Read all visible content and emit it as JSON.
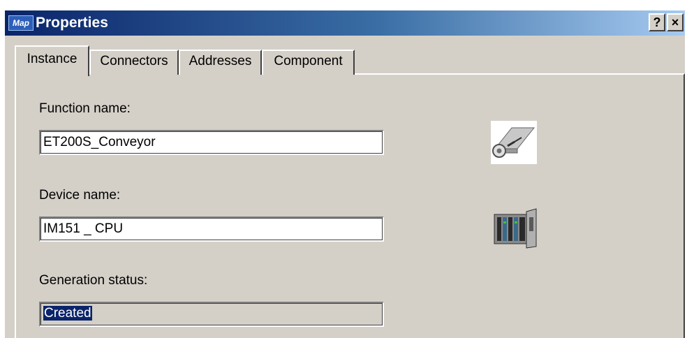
{
  "window": {
    "title": "Properties",
    "app_icon_text": "Map",
    "help_label": "?",
    "close_label": "×"
  },
  "tabs": [
    {
      "label": "Instance",
      "active": true
    },
    {
      "label": "Connectors",
      "active": false
    },
    {
      "label": "Addresses",
      "active": false
    },
    {
      "label": "Component",
      "active": false
    }
  ],
  "form": {
    "function_name_label": "Function name:",
    "function_name_value": "ET200S_Conveyor",
    "device_name_label": "Device name:",
    "device_name_value": "IM151 _ CPU",
    "generation_status_label": "Generation status:",
    "generation_status_value": "Created"
  },
  "icons": {
    "function_icon": "conveyor-icon",
    "device_icon": "cpu-rack-icon"
  },
  "colors": {
    "titlebar_start": "#0a246a",
    "titlebar_end": "#a6caf0",
    "dialog_face": "#d4d0c8",
    "selection": "#0a246a"
  }
}
